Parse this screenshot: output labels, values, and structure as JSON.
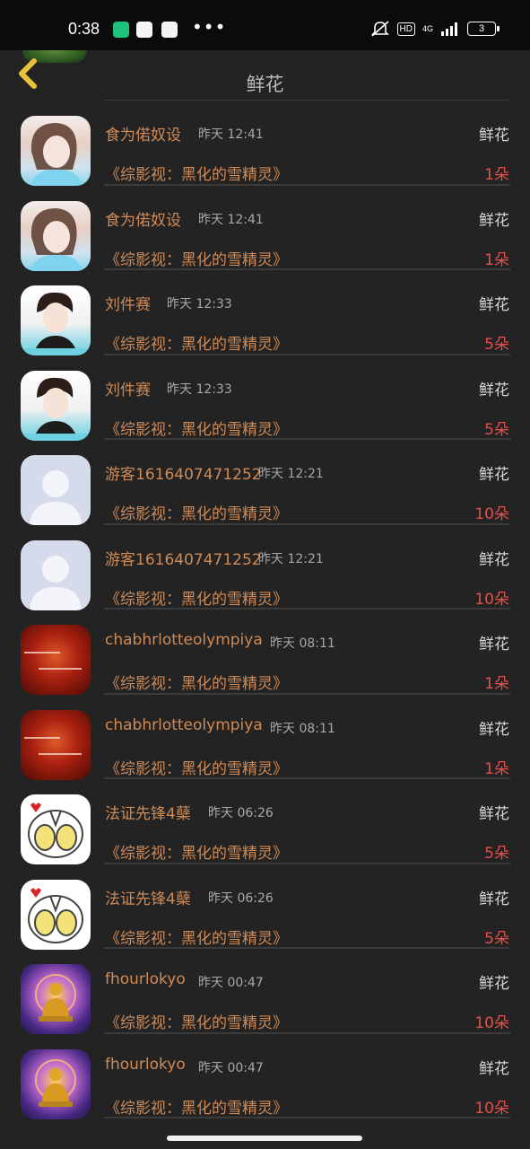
{
  "status_bar": {
    "time": "0:38",
    "dots": "•••",
    "hd": "HD",
    "network": "4G",
    "battery": "3"
  },
  "header": {
    "title": "鲜花"
  },
  "colors": {
    "name": "#d08a55",
    "count": "#e2504a",
    "back": "#e7c23b",
    "background": "#232323"
  },
  "rows": [
    {
      "avatar": "girl-avatar",
      "name": "食为偌奴设",
      "time": "昨天 12:41",
      "gift_type": "鲜花",
      "book": "《综影视：黑化的雪精灵》",
      "count": "1朵"
    },
    {
      "avatar": "girl-avatar",
      "name": "食为偌奴设",
      "time": "昨天 12:41",
      "gift_type": "鲜花",
      "book": "《综影视：黑化的雪精灵》",
      "count": "1朵"
    },
    {
      "avatar": "man-avatar",
      "name": "刘件赛",
      "time": "昨天 12:33",
      "gift_type": "鲜花",
      "book": "《综影视：黑化的雪精灵》",
      "count": "5朵"
    },
    {
      "avatar": "man-avatar",
      "name": "刘件赛",
      "time": "昨天 12:33",
      "gift_type": "鲜花",
      "book": "《综影视：黑化的雪精灵》",
      "count": "5朵"
    },
    {
      "avatar": "guest-avatar",
      "name": "游客1616407471252",
      "time": "昨天 12:21",
      "gift_type": "鲜花",
      "book": "《综影视：黑化的雪精灵》",
      "count": "10朵"
    },
    {
      "avatar": "guest-avatar",
      "name": "游客1616407471252",
      "time": "昨天 12:21",
      "gift_type": "鲜花",
      "book": "《综影视：黑化的雪精灵》",
      "count": "10朵"
    },
    {
      "avatar": "red-avatar",
      "name": "chabhrlotteolympiya",
      "time": "昨天 08:11",
      "gift_type": "鲜花",
      "book": "《综影视：黑化的雪精灵》",
      "count": "1朵"
    },
    {
      "avatar": "red-avatar",
      "name": "chabhrlotteolympiya",
      "time": "昨天 08:11",
      "gift_type": "鲜花",
      "book": "《综影视：黑化的雪精灵》",
      "count": "1朵"
    },
    {
      "avatar": "robot-avatar",
      "name": "法证先锋4蘖",
      "time": "昨天 06:26",
      "gift_type": "鲜花",
      "book": "《综影视：黑化的雪精灵》",
      "count": "5朵"
    },
    {
      "avatar": "robot-avatar",
      "name": "法证先锋4蘖",
      "time": "昨天 06:26",
      "gift_type": "鲜花",
      "book": "《综影视：黑化的雪精灵》",
      "count": "5朵"
    },
    {
      "avatar": "buddha-avatar",
      "name": "fhourlokyo",
      "time": "昨天 00:47",
      "gift_type": "鲜花",
      "book": "《综影视：黑化的雪精灵》",
      "count": "10朵"
    },
    {
      "avatar": "buddha-avatar",
      "name": "fhourlokyo",
      "time": "昨天 00:47",
      "gift_type": "鲜花",
      "book": "《综影视：黑化的雪精灵》",
      "count": "10朵"
    }
  ]
}
